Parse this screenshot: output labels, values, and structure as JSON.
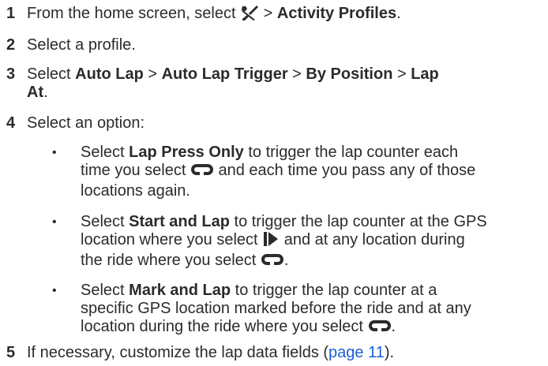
{
  "steps": [
    {
      "num": "1",
      "pre": "From the home screen, select ",
      "icon": "wrench-screwdriver-icon",
      "sep": " > ",
      "bold1": "Activity Profiles",
      "end": "."
    },
    {
      "num": "2",
      "text": "Select a profile."
    },
    {
      "num": "3",
      "pre": "Select ",
      "b1": "Auto Lap",
      "s1": " > ",
      "b2": "Auto Lap Trigger",
      "s2": " > ",
      "b3": "By Position",
      "s3": " > ",
      "b4": "Lap",
      "b5": "At",
      "end": "."
    },
    {
      "num": "4",
      "text": "Select an option:"
    },
    {
      "num": "5",
      "pre": "If necessary, customize the lap data fields (",
      "link": "page 11",
      "end": ")."
    }
  ],
  "bullets": [
    {
      "dot": "•",
      "pre": "Select ",
      "bold": "Lap Press Only",
      "l1": " to trigger the lap counter each",
      "l2a": "time you select ",
      "icon": "lap-icon",
      "l2b": " and each time you pass any of those",
      "l3": "locations again."
    },
    {
      "dot": "•",
      "pre": "Select ",
      "bold": "Start and Lap",
      "l1": " to trigger the lap counter at the GPS",
      "l2a": "location where you select ",
      "icon1": "start-icon",
      "l2b": " and at any location during",
      "l3a": "the ride where you select ",
      "icon2": "lap-icon",
      "l3b": "."
    },
    {
      "dot": "•",
      "pre": "Select ",
      "bold": "Mark and Lap",
      "l1": " to trigger the lap counter at a",
      "l2": "specific GPS location marked before the ride and at any",
      "l3a": "location during the ride where you select ",
      "icon": "lap-icon",
      "l3b": "."
    }
  ],
  "colors": {
    "text": "#2b2b2b",
    "link": "#1a5fd6"
  }
}
